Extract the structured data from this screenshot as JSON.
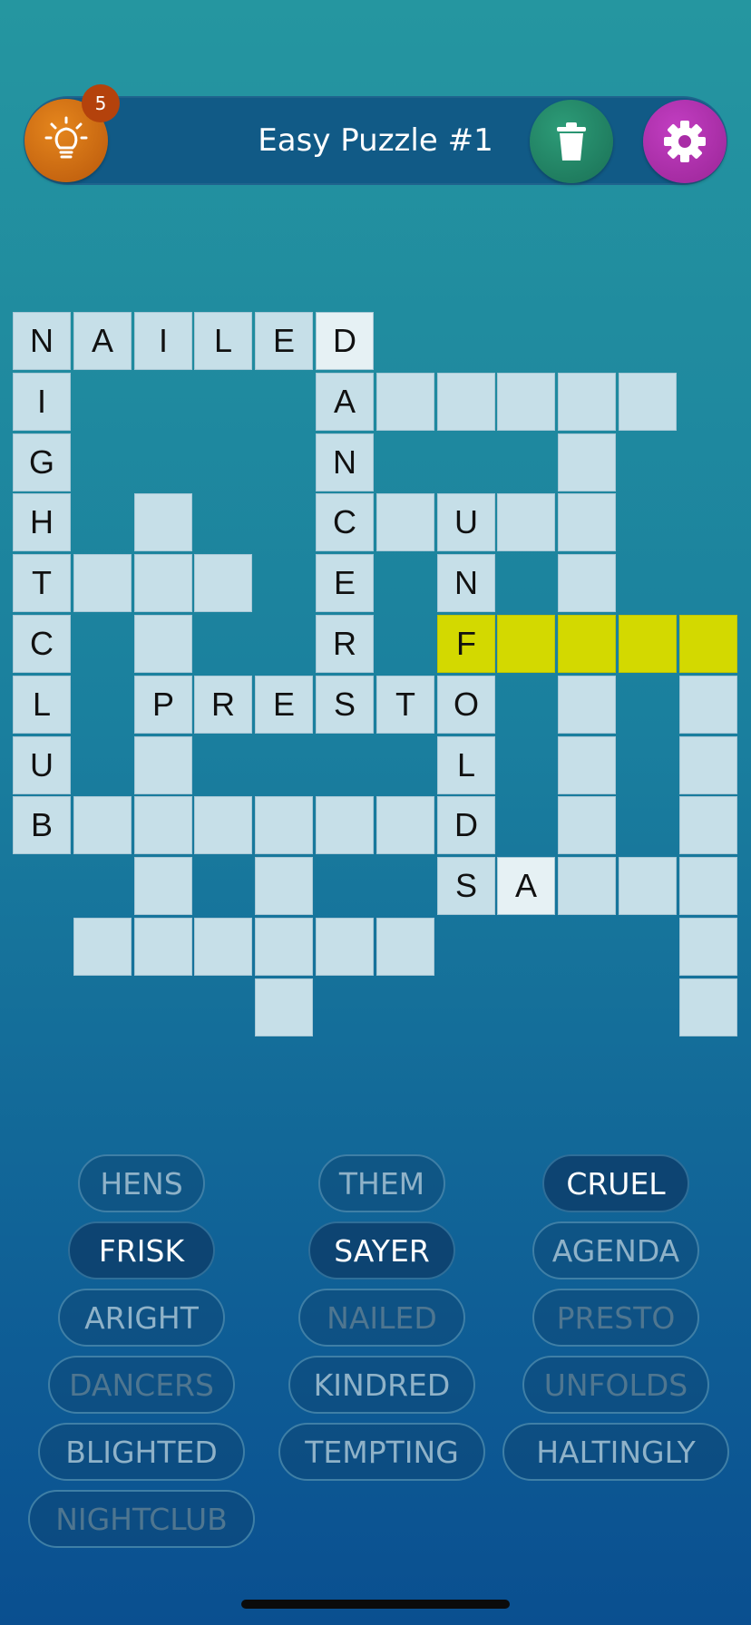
{
  "header": {
    "title": "Easy Puzzle #1",
    "hint_count": "5",
    "icons": {
      "hint": "lightbulb-icon",
      "clear": "trash-icon",
      "settings": "gear-icon"
    }
  },
  "grid": {
    "cells": [
      {
        "r": 0,
        "c": 0,
        "ch": "N"
      },
      {
        "r": 0,
        "c": 1,
        "ch": "A"
      },
      {
        "r": 0,
        "c": 2,
        "ch": "I"
      },
      {
        "r": 0,
        "c": 3,
        "ch": "L"
      },
      {
        "r": 0,
        "c": 4,
        "ch": "E"
      },
      {
        "r": 0,
        "c": 5,
        "ch": "D",
        "state": "selected"
      },
      {
        "r": 1,
        "c": 0,
        "ch": "I"
      },
      {
        "r": 1,
        "c": 5,
        "ch": "A"
      },
      {
        "r": 1,
        "c": 6
      },
      {
        "r": 1,
        "c": 7
      },
      {
        "r": 1,
        "c": 8
      },
      {
        "r": 1,
        "c": 9
      },
      {
        "r": 1,
        "c": 10
      },
      {
        "r": 2,
        "c": 0,
        "ch": "G"
      },
      {
        "r": 2,
        "c": 5,
        "ch": "N"
      },
      {
        "r": 2,
        "c": 9
      },
      {
        "r": 3,
        "c": 0,
        "ch": "H"
      },
      {
        "r": 3,
        "c": 2
      },
      {
        "r": 3,
        "c": 5,
        "ch": "C"
      },
      {
        "r": 3,
        "c": 6
      },
      {
        "r": 3,
        "c": 7,
        "ch": "U"
      },
      {
        "r": 3,
        "c": 8
      },
      {
        "r": 3,
        "c": 9
      },
      {
        "r": 4,
        "c": 0,
        "ch": "T"
      },
      {
        "r": 4,
        "c": 1
      },
      {
        "r": 4,
        "c": 2
      },
      {
        "r": 4,
        "c": 3
      },
      {
        "r": 4,
        "c": 5,
        "ch": "E"
      },
      {
        "r": 4,
        "c": 7,
        "ch": "N"
      },
      {
        "r": 4,
        "c": 9
      },
      {
        "r": 5,
        "c": 0,
        "ch": "C"
      },
      {
        "r": 5,
        "c": 2
      },
      {
        "r": 5,
        "c": 5,
        "ch": "R"
      },
      {
        "r": 5,
        "c": 7,
        "ch": "F",
        "state": "highlight"
      },
      {
        "r": 5,
        "c": 8,
        "state": "highlight"
      },
      {
        "r": 5,
        "c": 9,
        "state": "highlight"
      },
      {
        "r": 5,
        "c": 10,
        "state": "highlight"
      },
      {
        "r": 5,
        "c": 11,
        "state": "highlight"
      },
      {
        "r": 6,
        "c": 0,
        "ch": "L"
      },
      {
        "r": 6,
        "c": 2,
        "ch": "P"
      },
      {
        "r": 6,
        "c": 3,
        "ch": "R"
      },
      {
        "r": 6,
        "c": 4,
        "ch": "E"
      },
      {
        "r": 6,
        "c": 5,
        "ch": "S"
      },
      {
        "r": 6,
        "c": 6,
        "ch": "T"
      },
      {
        "r": 6,
        "c": 7,
        "ch": "O"
      },
      {
        "r": 6,
        "c": 9
      },
      {
        "r": 6,
        "c": 11
      },
      {
        "r": 7,
        "c": 0,
        "ch": "U"
      },
      {
        "r": 7,
        "c": 2
      },
      {
        "r": 7,
        "c": 7,
        "ch": "L"
      },
      {
        "r": 7,
        "c": 9
      },
      {
        "r": 7,
        "c": 11
      },
      {
        "r": 8,
        "c": 0,
        "ch": "B"
      },
      {
        "r": 8,
        "c": 1
      },
      {
        "r": 8,
        "c": 2
      },
      {
        "r": 8,
        "c": 3
      },
      {
        "r": 8,
        "c": 4
      },
      {
        "r": 8,
        "c": 5
      },
      {
        "r": 8,
        "c": 6
      },
      {
        "r": 8,
        "c": 7,
        "ch": "D"
      },
      {
        "r": 8,
        "c": 9
      },
      {
        "r": 8,
        "c": 11
      },
      {
        "r": 9,
        "c": 2
      },
      {
        "r": 9,
        "c": 4
      },
      {
        "r": 9,
        "c": 7,
        "ch": "S"
      },
      {
        "r": 9,
        "c": 8,
        "ch": "A",
        "state": "selected"
      },
      {
        "r": 9,
        "c": 9
      },
      {
        "r": 9,
        "c": 10
      },
      {
        "r": 9,
        "c": 11
      },
      {
        "r": 10,
        "c": 1
      },
      {
        "r": 10,
        "c": 2
      },
      {
        "r": 10,
        "c": 3
      },
      {
        "r": 10,
        "c": 4
      },
      {
        "r": 10,
        "c": 5
      },
      {
        "r": 10,
        "c": 6
      },
      {
        "r": 10,
        "c": 11
      },
      {
        "r": 11,
        "c": 4
      },
      {
        "r": 11,
        "c": 11
      }
    ]
  },
  "word_bank": [
    {
      "word": "HENS",
      "state": "unused"
    },
    {
      "word": "THEM",
      "state": "unused"
    },
    {
      "word": "CRUEL",
      "state": "active"
    },
    {
      "word": "FRISK",
      "state": "active"
    },
    {
      "word": "SAYER",
      "state": "active"
    },
    {
      "word": "AGENDA",
      "state": "unused"
    },
    {
      "word": "ARIGHT",
      "state": "unused"
    },
    {
      "word": "NAILED",
      "state": "placed"
    },
    {
      "word": "PRESTO",
      "state": "placed"
    },
    {
      "word": "DANCERS",
      "state": "placed"
    },
    {
      "word": "KINDRED",
      "state": "unused"
    },
    {
      "word": "UNFOLDS",
      "state": "placed"
    },
    {
      "word": "BLIGHTED",
      "state": "unused"
    },
    {
      "word": "TEMPTING",
      "state": "unused"
    },
    {
      "word": "HALTINGLY",
      "state": "unused"
    },
    {
      "word": "NIGHTCLUB",
      "state": "placed"
    }
  ]
}
